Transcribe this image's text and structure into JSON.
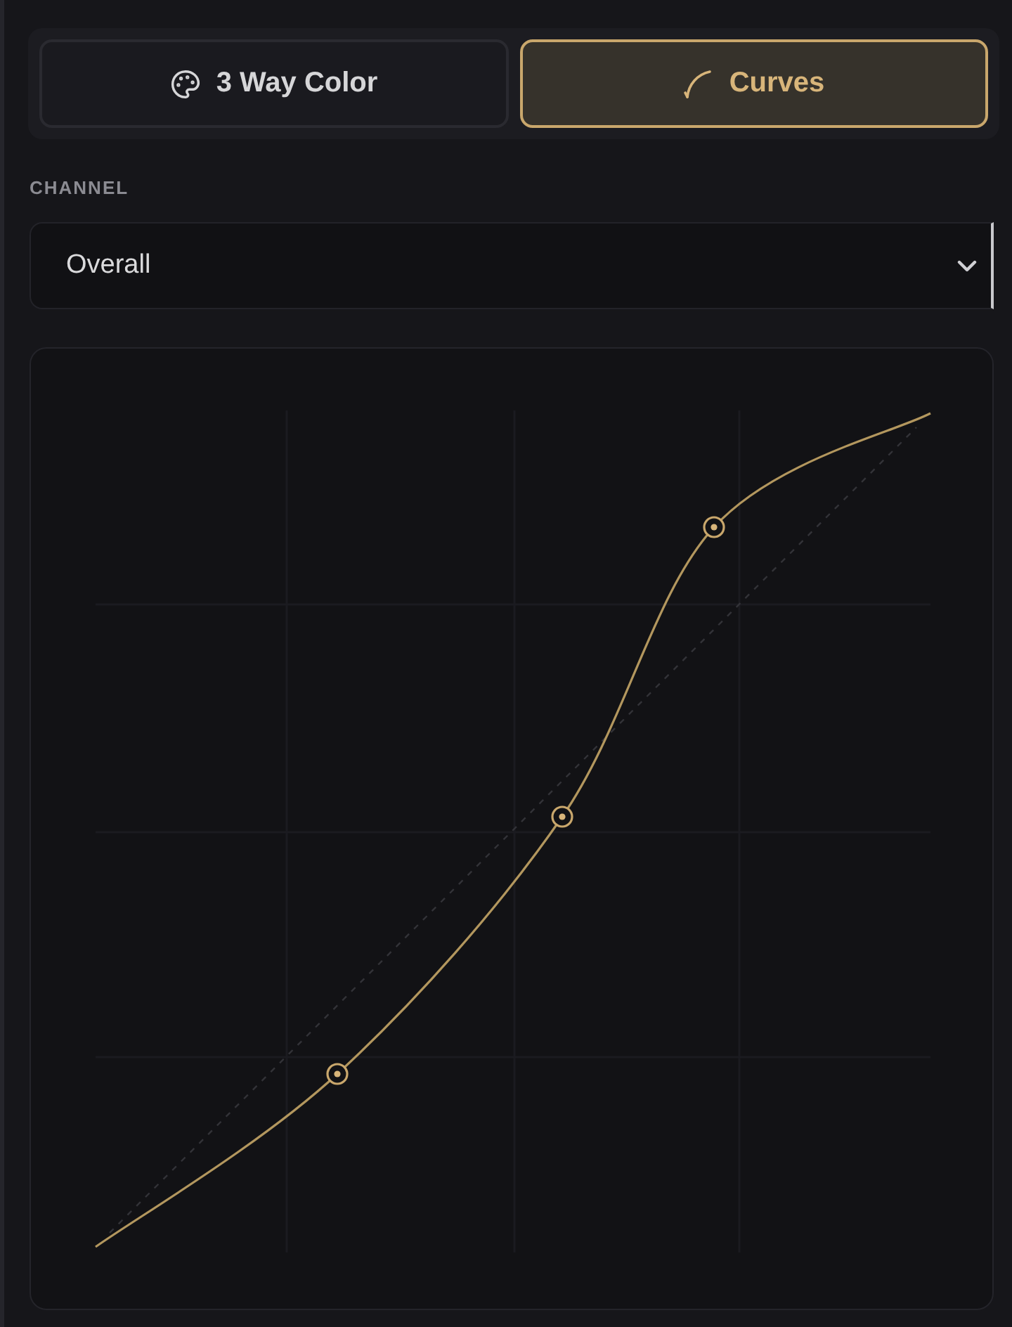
{
  "tabs": [
    {
      "label": "3 Way Color",
      "selected": false
    },
    {
      "label": "Curves",
      "selected": true
    }
  ],
  "channel": {
    "label": "CHANNEL",
    "value": "Overall"
  }
}
